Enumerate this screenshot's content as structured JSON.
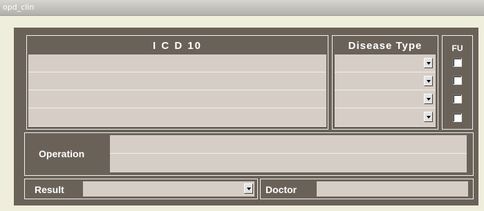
{
  "window": {
    "title": "opd_clin"
  },
  "icd": {
    "header": "I C D  10",
    "rows": [
      "",
      "",
      "",
      ""
    ]
  },
  "disease_type": {
    "header": "Disease  Type",
    "rows": [
      "",
      "",
      "",
      ""
    ]
  },
  "fu": {
    "header": "FU",
    "checked": [
      false,
      false,
      false,
      false
    ]
  },
  "operation": {
    "label": "Operation",
    "lines": [
      "",
      ""
    ]
  },
  "result": {
    "label": "Result",
    "value": ""
  },
  "doctor": {
    "label": "Doctor",
    "value": ""
  },
  "colors": {
    "panel": "#6a6259",
    "field": "#d6cec6",
    "page": "#efeedc"
  }
}
